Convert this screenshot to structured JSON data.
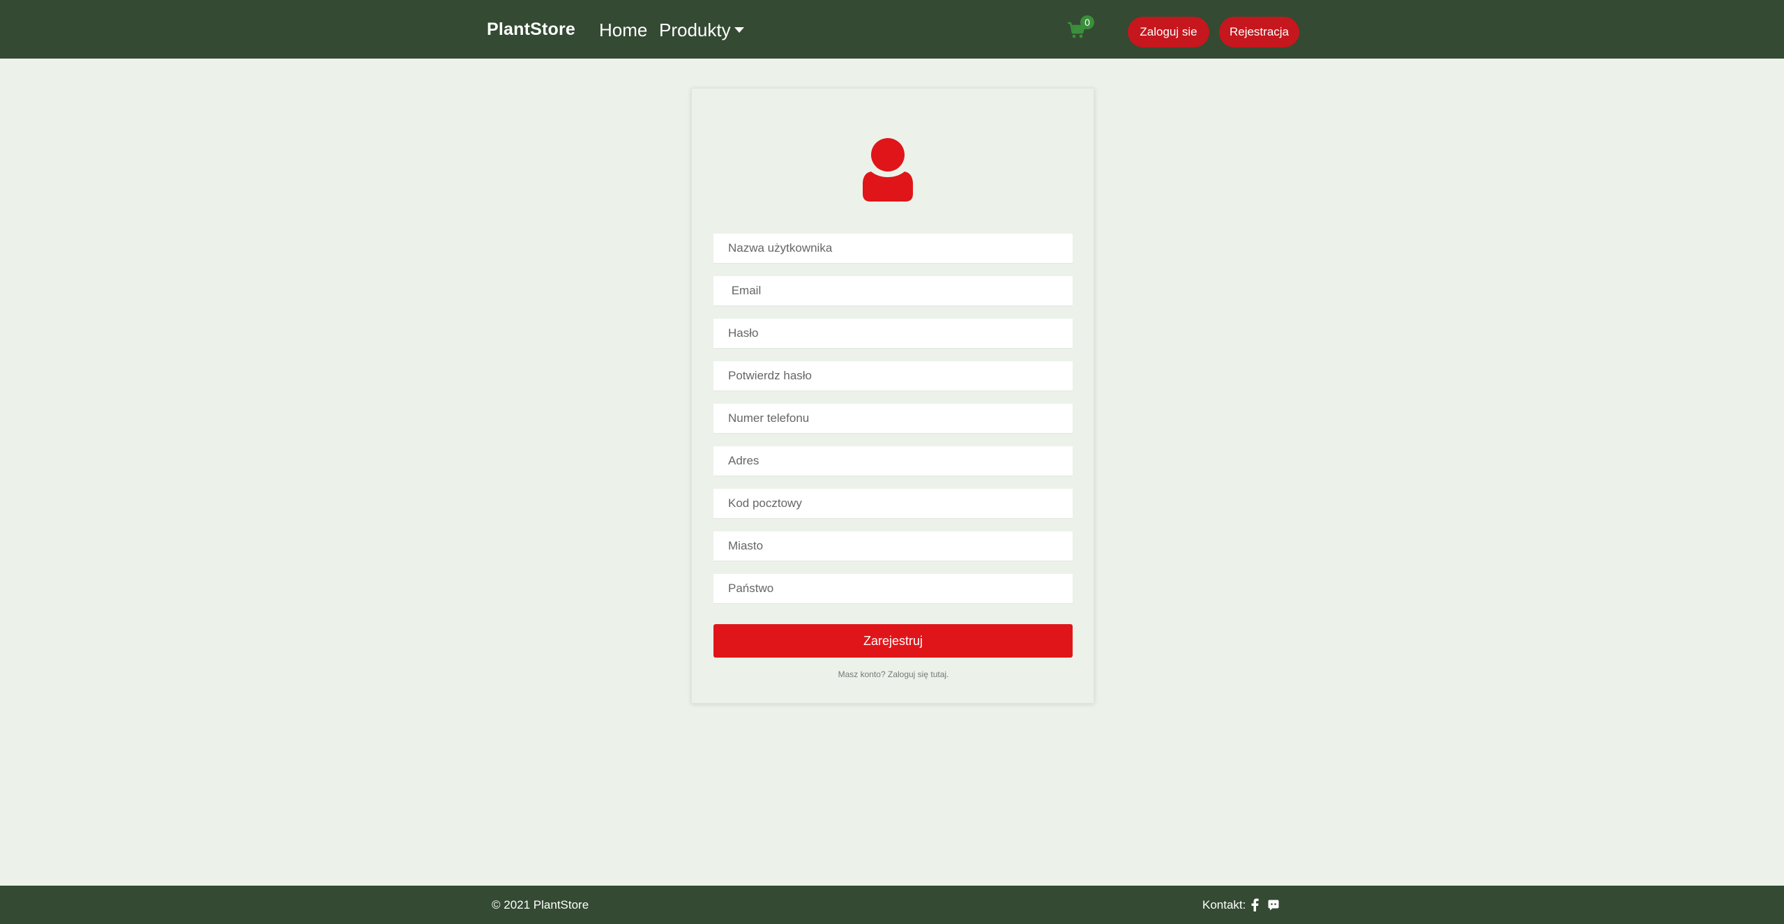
{
  "navbar": {
    "brand": "PlantStore",
    "links": {
      "home": "Home",
      "products": "Produkty"
    },
    "cart_count": "0",
    "login_label": "Zaloguj sie",
    "register_label": "Rejestracja",
    "cart_icon": "shopping-cart-icon"
  },
  "form": {
    "avatar_icon": "user-icon",
    "fields": {
      "username": "Nazwa użytkownika",
      "email": " Email",
      "password": "Hasło",
      "confirm_password": "Potwierdz hasło",
      "phone": "Numer telefonu",
      "address": "Adres",
      "postal_code": "Kod pocztowy",
      "city": "Miasto",
      "country": "Państwo"
    },
    "submit_label": "Zarejestruj",
    "login_hint": "Masz konto? Zaloguj się tutaj."
  },
  "footer": {
    "copyright": "© 2021 PlantStore",
    "contact_label": "Kontakt:",
    "icons": [
      "facebook-icon",
      "discord-icon"
    ]
  },
  "colors": {
    "navbar_bg": "#344a33",
    "page_bg": "#ecf2ea",
    "accent_red": "#e01519",
    "pill_red": "#c5171d",
    "badge_green": "#3a8f3a"
  }
}
